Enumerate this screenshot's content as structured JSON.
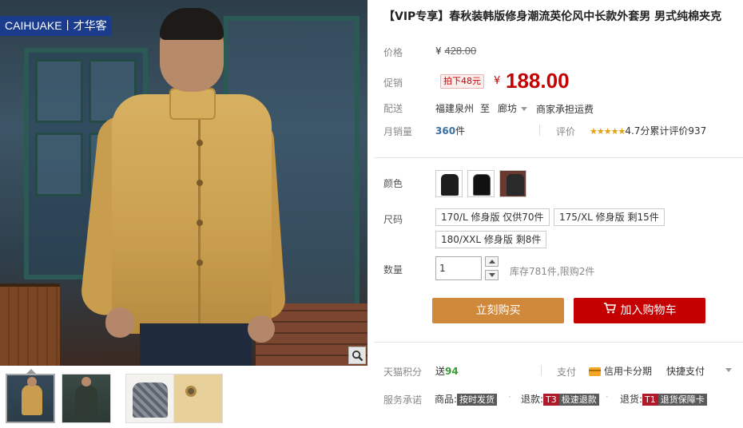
{
  "brand": {
    "logo_text": "CAIHUAKE丨才华客"
  },
  "product": {
    "title": "【VIP专享】春秋装韩版修身潮流英伦风中长款外套男 男式纯棉夹克"
  },
  "price": {
    "label": "价格",
    "currency": "¥",
    "original": "428.00"
  },
  "promo": {
    "label": "促销",
    "tag": "拍下48元",
    "currency": "¥",
    "price": "188.00"
  },
  "shipping": {
    "label": "配送",
    "from": "福建泉州",
    "to_word": "至",
    "to": "廊坊",
    "fee": "商家承担运费"
  },
  "sales": {
    "label": "月销量",
    "count": "360",
    "unit": "件",
    "review_label": "评价",
    "stars": "★★★★★",
    "score": "4.7分",
    "review_count": "累计评价937"
  },
  "color": {
    "label": "颜色",
    "options": [
      "khaki-jacket",
      "black-jacket",
      "model-photo"
    ]
  },
  "size": {
    "label": "尺码",
    "options": [
      "170/L 修身版 仅供70件",
      "175/XL 修身版 剩15件",
      "180/XXL 修身版 剩8件"
    ]
  },
  "quantity": {
    "label": "数量",
    "value": "1",
    "stock": "库存781件,限购2件"
  },
  "actions": {
    "buy_now": "立刻购买",
    "add_to_cart": "加入购物车"
  },
  "points": {
    "label": "天猫积分",
    "prefix": "送",
    "value": "94",
    "pay_label": "支付",
    "credit_installment": "信用卡分期",
    "quick_pay": "快捷支付"
  },
  "services": {
    "label": "服务承诺",
    "items": [
      {
        "prefix": "商品:",
        "badge": "按时发货"
      },
      {
        "prefix": "退款:",
        "code": "T3",
        "badge": "极速退款"
      },
      {
        "prefix": "退货:",
        "code": "T1",
        "badge": "退货保障卡"
      }
    ]
  },
  "colors": {
    "price_red": "#c40000",
    "buy_now": "#d0883a",
    "cart": "#c40000",
    "logo_bg": "#1b3c8c"
  }
}
